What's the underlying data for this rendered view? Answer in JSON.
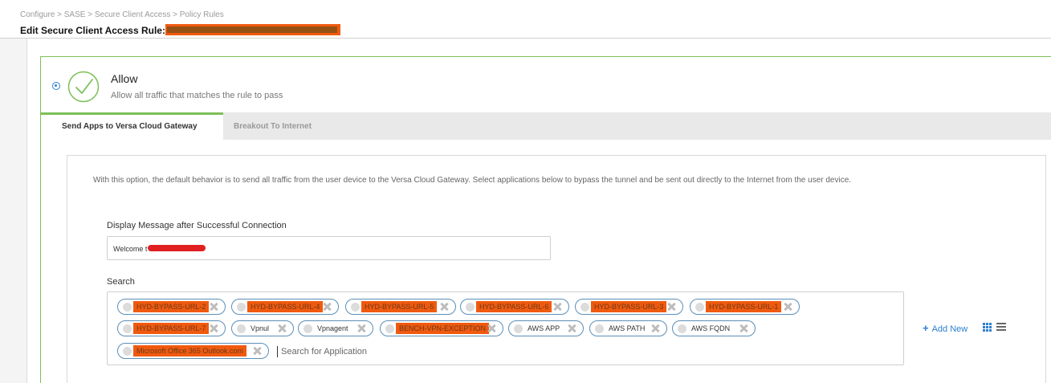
{
  "header": {
    "breadcrumb": "Configure > SASE > Secure Client Access > Policy Rules",
    "title": "Edit Secure Client Access Rule:"
  },
  "action": {
    "title": "Allow",
    "description": "Allow all traffic that matches the rule to pass"
  },
  "tabs": [
    {
      "label": "Send Apps to Versa Cloud Gateway",
      "active": true
    },
    {
      "label": "Breakout To Internet",
      "active": false
    }
  ],
  "content": {
    "info": "With this option, the default behavior is to send all traffic from the user device to the Versa Cloud Gateway. Select applications below to bypass the tunnel and be sent out directly to the Internet from the user device.",
    "message_label": "Display Message after Successful Connection",
    "message_value": "Welcome t",
    "search_label": "Search",
    "search_placeholder": "Search for Application",
    "chips": [
      {
        "label": "HYD-BYPASS-URL-2"
      },
      {
        "label": "HYD-BYPASS-URL-4"
      },
      {
        "label": "HYD-BYPASS-URL-5"
      },
      {
        "label": "HYD-BYPASS-URL-6"
      },
      {
        "label": "HYD-BYPASS-URL-3"
      },
      {
        "label": "HYD-BYPASS-URL-1"
      },
      {
        "label": "HYD-BYPASS-URL-7"
      },
      {
        "label": "Vpnul"
      },
      {
        "label": "Vpnagent"
      },
      {
        "label": "BENCH-VPN-EXCEPTION"
      },
      {
        "label": "AWS APP"
      },
      {
        "label": "AWS PATH"
      },
      {
        "label": "AWS FQDN"
      },
      {
        "label": "Microsoft Office 365 Outlook.com"
      }
    ],
    "add_new_label": "Add New"
  },
  "colors": {
    "accent": "#2c7fd0",
    "success": "#7cbf58",
    "redaction_orange": "#f05a0f",
    "redaction_red": "#e02020"
  }
}
